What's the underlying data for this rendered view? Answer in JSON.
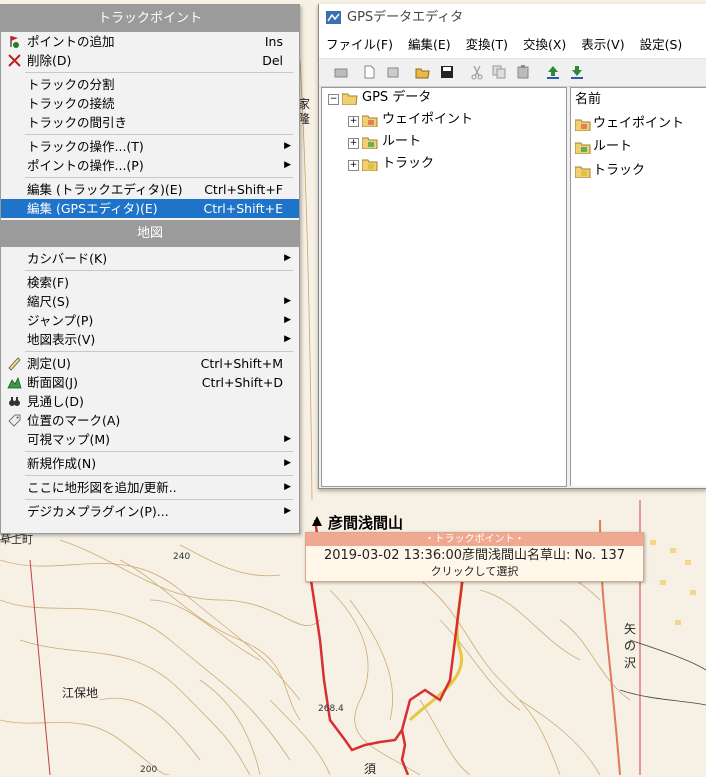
{
  "context_menu": {
    "header1": "トラックポイント",
    "add_point": {
      "label": "ポイントの追加",
      "shortcut": "Ins"
    },
    "delete": {
      "label": "削除(D)",
      "shortcut": "Del"
    },
    "split": "トラックの分割",
    "join": "トラックの接続",
    "thin": "トラックの間引き",
    "track_ops": "トラックの操作...(T)",
    "point_ops": "ポイントの操作...(P)",
    "edit_track": {
      "label": "編集 (トラックエディタ)(E)",
      "shortcut": "Ctrl+Shift+F"
    },
    "edit_gps": {
      "label": "編集 (GPSエディタ)(E)",
      "shortcut": "Ctrl+Shift+E"
    },
    "header2": "地図",
    "kashmir": "カシバード(K)",
    "search": "検索(F)",
    "scale": "縮尺(S)",
    "jump": "ジャンプ(P)",
    "map_display": "地図表示(V)",
    "measure": {
      "label": "測定(U)",
      "shortcut": "Ctrl+Shift+M"
    },
    "profile": {
      "label": "断面図(J)",
      "shortcut": "Ctrl+Shift+D"
    },
    "view": "見通し(D)",
    "mark": "位置のマーク(A)",
    "visible_map": "可視マップ(M)",
    "new": "新規作成(N)",
    "add_topo": "ここに地形図を追加/更新..",
    "camera": "デジカメプラグイン(P)..."
  },
  "gps_window": {
    "title": "GPSデータエディタ",
    "menu": [
      "ファイル(F)",
      "編集(E)",
      "変換(T)",
      "交換(X)",
      "表示(V)",
      "設定(S)"
    ],
    "tree": {
      "root": "GPS データ",
      "waypoint": "ウェイポイント",
      "route": "ルート",
      "track": "トラック"
    },
    "list": {
      "header": "名前",
      "items": [
        "ウェイポイント",
        "ルート",
        "トラック"
      ]
    }
  },
  "map": {
    "peak": "彦間浅間山",
    "labels": [
      "家",
      "隆",
      "江保地",
      "草上町",
      "矢",
      "の",
      "沢",
      "240",
      "268.4",
      "200",
      "須"
    ]
  },
  "tooltip": {
    "header": "・トラックポイント・",
    "main": "2019-03-02 13:36:00彦間浅間山名草山: No. 137",
    "sub": "クリックして選択"
  }
}
